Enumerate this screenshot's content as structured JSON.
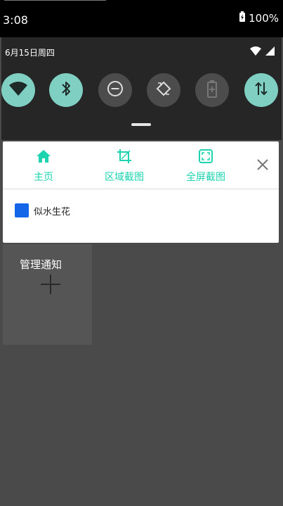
{
  "status": {
    "time": "3:08",
    "battery": "100%"
  },
  "quick_settings": {
    "date": "6月15日周四",
    "tiles": [
      {
        "icon": "wifi-icon",
        "state": "on"
      },
      {
        "icon": "bluetooth-icon",
        "state": "on"
      },
      {
        "icon": "do-not-disturb-icon",
        "state": "off"
      },
      {
        "icon": "auto-rotate-icon",
        "state": "off"
      },
      {
        "icon": "battery-saver-icon",
        "state": "off"
      },
      {
        "icon": "data-transfer-icon",
        "state": "on"
      }
    ]
  },
  "notification": {
    "nav": {
      "home_label": "主页",
      "region_label": "区域截图",
      "fullscreen_label": "全屏截图"
    },
    "app_name": "似水生花"
  },
  "manage": {
    "title": "管理通知"
  },
  "colors": {
    "accent": "#1dd3b0",
    "tile_on": "#7fcfc3",
    "tile_off": "#4c4c4c",
    "app_icon": "#1466e8"
  }
}
